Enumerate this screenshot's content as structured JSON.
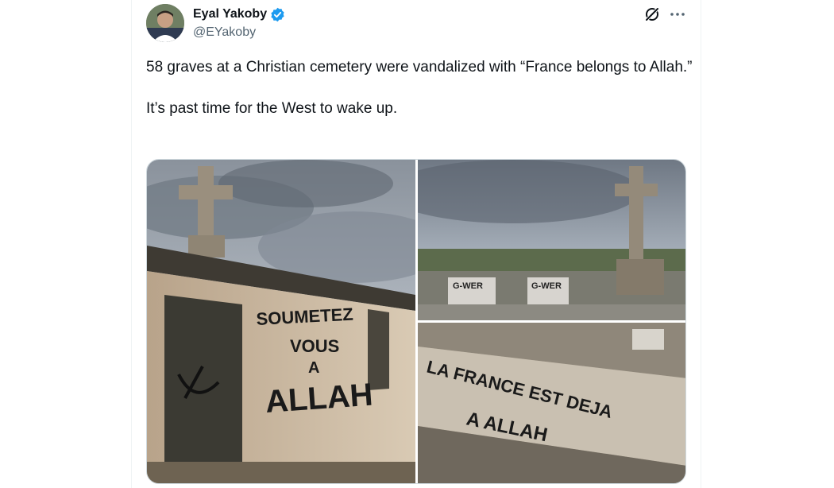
{
  "author": {
    "name": "Eyal Yakoby",
    "handle": "@EYakoby",
    "verified": true,
    "avatar_icon": "profile-photo"
  },
  "tweet": {
    "text": "58 graves at a Christian cemetery were vandalized with “France belongs to Allah.”\n\nIt’s past time for the West to wake up."
  },
  "actions": {
    "grok_icon": "grok-icon",
    "more_icon": "more-icon"
  },
  "media": {
    "photos": [
      {
        "graffiti": [
          "SOUMETEZ",
          "VOUS",
          "A",
          "ALLAH"
        ]
      },
      {
        "graffiti": [
          "G-WER",
          "G-WER"
        ]
      },
      {
        "graffiti": [
          "LA FRANCE EST DEJA",
          "A ALLAH"
        ]
      }
    ]
  },
  "colors": {
    "text": "#0f1419",
    "secondary": "#536471",
    "verified": "#1d9bf0",
    "border": "#cfd9de"
  }
}
